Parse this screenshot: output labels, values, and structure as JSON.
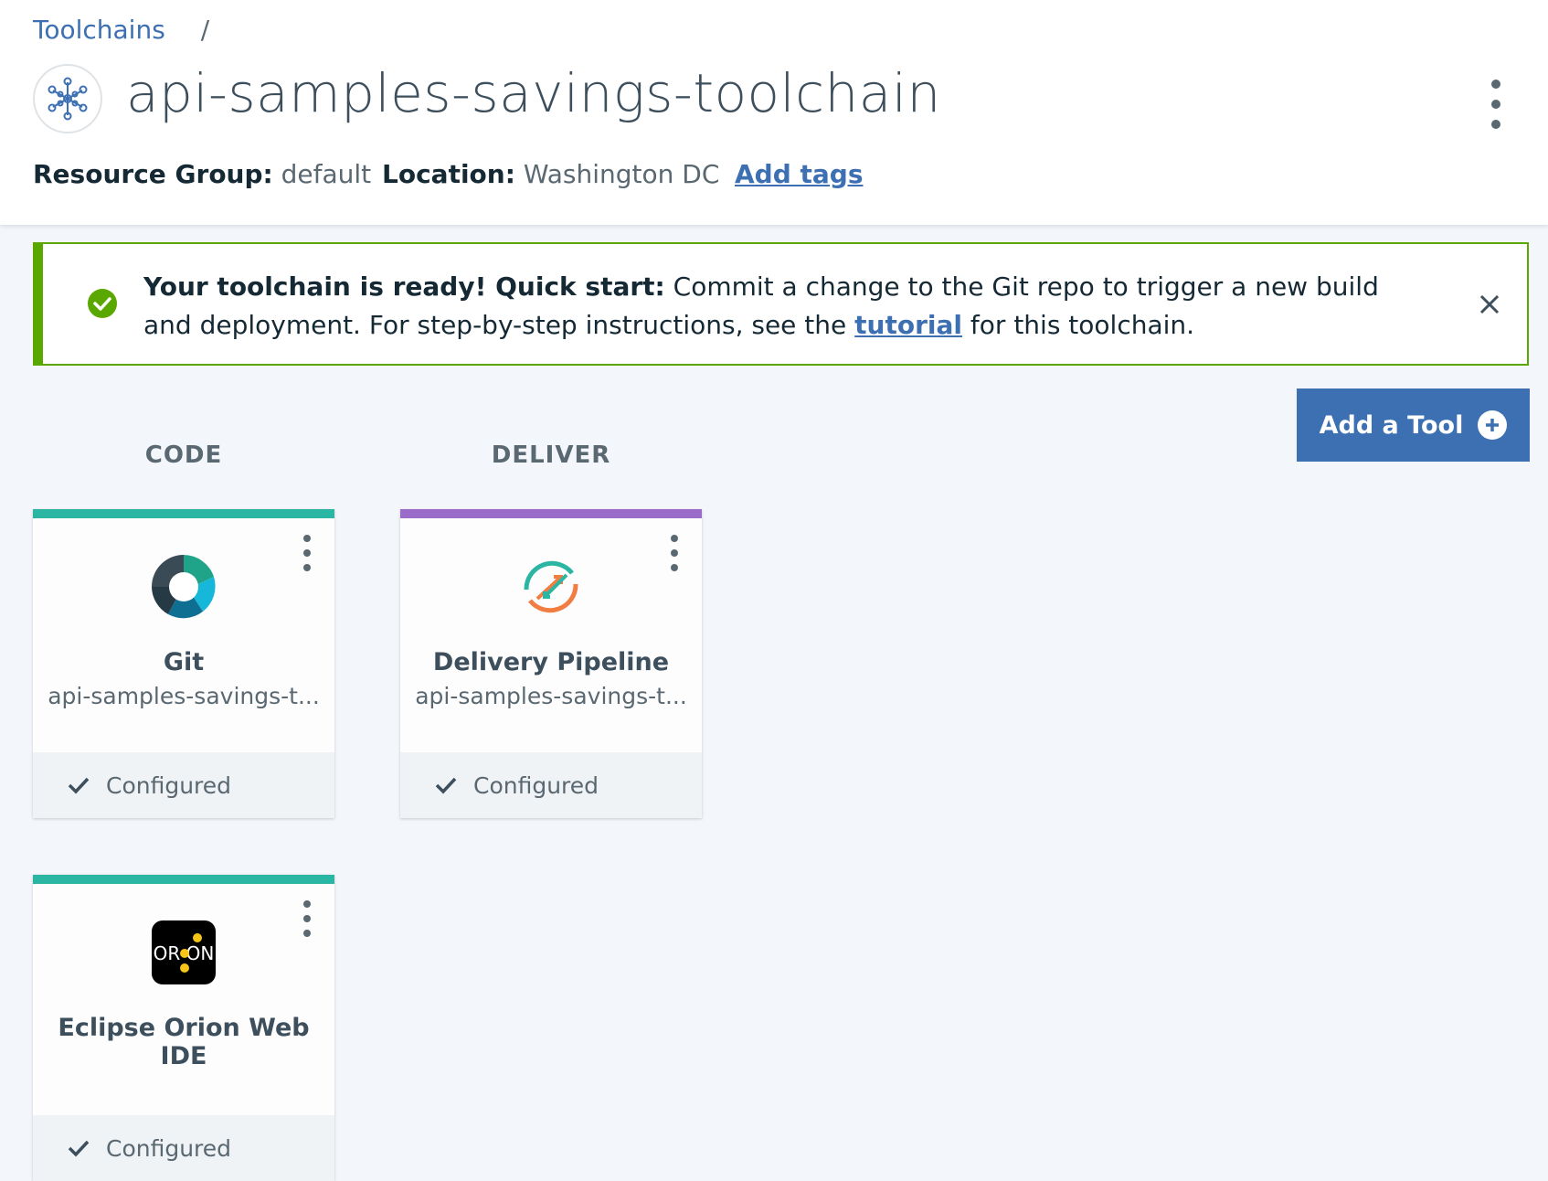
{
  "breadcrumb": {
    "root": "Toolchains",
    "separator": "/"
  },
  "page_title": "api-samples-savings-toolchain",
  "meta": {
    "resource_group_label": "Resource Group:",
    "resource_group_value": "default",
    "location_label": "Location:",
    "location_value": "Washington DC",
    "add_tags": "Add tags"
  },
  "notice": {
    "strong": "Your toolchain is ready! Quick start:",
    "text_before_link": " Commit a change to the Git repo to trigger a new build and deployment. For step-by-step instructions, see the ",
    "link": "tutorial",
    "text_after_link": " for this toolchain."
  },
  "add_tool_button": "Add a Tool",
  "columns": {
    "code": "CODE",
    "deliver": "DELIVER"
  },
  "cards": [
    {
      "name": "Git",
      "subtitle": "api-samples-savings-t...",
      "status": "Configured",
      "accent": "#2bb5a3",
      "icon": "git-icon"
    },
    {
      "name": "Delivery Pipeline",
      "subtitle": "api-samples-savings-t...",
      "status": "Configured",
      "accent": "#9b6bc9",
      "icon": "pipeline-icon"
    },
    {
      "name": "Eclipse Orion Web IDE",
      "subtitle": "",
      "status": "Configured",
      "accent": "#2bb5a3",
      "icon": "orion-icon"
    }
  ],
  "colors": {
    "primary": "#3d70b2",
    "success": "#5aa700",
    "background": "#f3f6fa"
  }
}
